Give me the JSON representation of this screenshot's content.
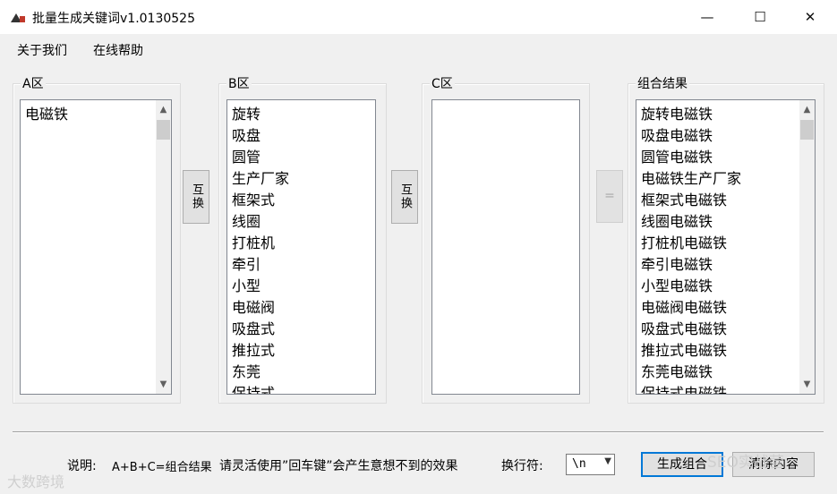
{
  "window": {
    "title": "批量生成关键词v1.0130525",
    "minimize_glyph": "—",
    "maximize_glyph": "☐",
    "close_glyph": "✕"
  },
  "menu": [
    {
      "label": "关于我们"
    },
    {
      "label": "在线帮助"
    }
  ],
  "groups": {
    "a": {
      "label": "A区",
      "items": [
        "电磁铁"
      ]
    },
    "b": {
      "label": "B区",
      "items": [
        "旋转",
        "吸盘",
        "圆管",
        "生产厂家",
        "框架式",
        "线圈",
        "打桩机",
        "牵引",
        "小型",
        "电磁阀",
        "吸盘式",
        "推拉式",
        "东莞",
        "保持式"
      ]
    },
    "c": {
      "label": "C区",
      "items": []
    },
    "result": {
      "label": "组合结果",
      "items": [
        "旋转电磁铁",
        "吸盘电磁铁",
        "圆管电磁铁",
        "电磁铁生产厂家",
        "框架式电磁铁",
        "线圈电磁铁",
        "打桩机电磁铁",
        "牵引电磁铁",
        "小型电磁铁",
        "电磁阀电磁铁",
        "吸盘式电磁铁",
        "推拉式电磁铁",
        "东莞电磁铁",
        "保持式电磁铁"
      ]
    }
  },
  "buttons": {
    "swap1": "互换",
    "swap2": "互换",
    "equals": "=",
    "generate": "生成组合",
    "clear": "清除内容"
  },
  "bottom": {
    "desc_label": "说明:",
    "formula": "A+B+C=组合结果",
    "note": "请灵活使用”回车键”会产生意想不到的效果",
    "newline_label": "换行符:",
    "newline_value": "\\n"
  },
  "watermarks": {
    "left": "大数跨境",
    "right": "SEO实战营"
  }
}
